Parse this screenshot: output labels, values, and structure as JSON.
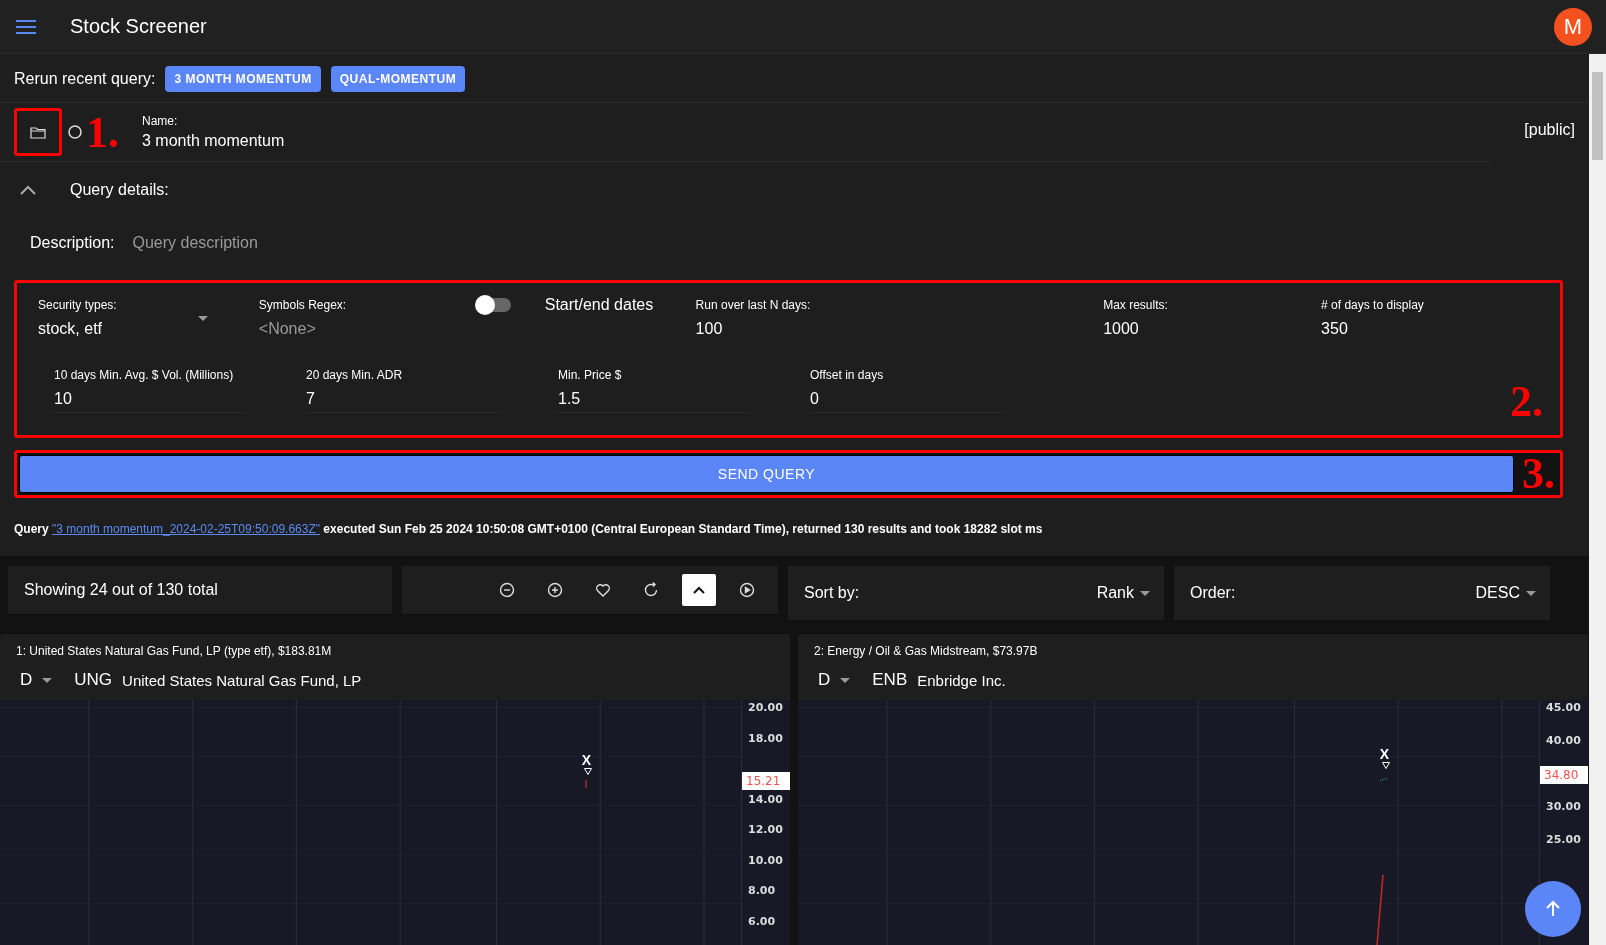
{
  "app_bar": {
    "title": "Stock Screener",
    "avatar": "M"
  },
  "recent_queries": {
    "label": "Rerun recent query:",
    "items": [
      "3 MONTH MOMENTUM",
      "QUAL-MOMENTUM"
    ]
  },
  "query": {
    "name_label": "Name:",
    "name": "3 month momentum",
    "visibility": "[public]",
    "details_label": "Query details:",
    "expanded": true,
    "description_label": "Description:",
    "description_placeholder": "Query description"
  },
  "filters": {
    "row_1": [
      {
        "kind": "select",
        "label": "Security types:",
        "value": "stock, etf"
      },
      {
        "kind": "field",
        "label": "Symbols Regex:",
        "placeholder": "<None>"
      },
      {
        "kind": "toggle",
        "label": "Start/end dates",
        "on": false
      },
      {
        "kind": "field",
        "label": "Run over last N days:",
        "value": "100"
      },
      {
        "kind": "field",
        "label": "Max results:",
        "value": "1000"
      },
      {
        "kind": "field",
        "label": "# of days to display",
        "value": "350"
      }
    ],
    "row_2": [
      {
        "label": "10 days Min. Avg. $ Vol. (Millions)",
        "value": "10"
      },
      {
        "label": "20 days Min. ADR",
        "value": "7"
      },
      {
        "label": "Min. Price $",
        "value": "1.5"
      },
      {
        "label": "Offset in days",
        "value": "0"
      }
    ]
  },
  "send_button": "SEND QUERY",
  "status": {
    "prefix": "Query",
    "link": "\"3 month momentum_2024-02-25T09:50:09.663Z\"",
    "rest": "executed Sun Feb 25 2024 10:50:08 GMT+0100 (Central European Standard Time), returned 130 results and took 18282 slot ms"
  },
  "results": {
    "summary": "Showing 24 out of 130 total",
    "toolbar": [
      {
        "kind": "zoom-out",
        "selected": false
      },
      {
        "kind": "zoom-in",
        "selected": false
      },
      {
        "kind": "favorite",
        "selected": false
      },
      {
        "kind": "refresh",
        "selected": false
      },
      {
        "kind": "collapse",
        "selected": true
      },
      {
        "kind": "play",
        "selected": false
      }
    ],
    "sort": {
      "label": "Sort by:",
      "value": "Rank"
    },
    "order": {
      "label": "Order:",
      "value": "DESC"
    }
  },
  "charts": [
    {
      "title": "1: United States Natural Gas Fund, LP (type etf), $183.81M",
      "interval": "D",
      "symbol": "UNG",
      "name": "United States Natural Gas Fund, LP",
      "y_labels": [
        "20.00",
        "18.00",
        "14.00",
        "12.00",
        "10.00",
        "8.00",
        "6.00"
      ],
      "last_price": "15.21",
      "marker": "X"
    },
    {
      "title": "2: Energy / Oil & Gas Midstream, $73.97B",
      "interval": "D",
      "symbol": "ENB",
      "name": "Enbridge Inc.",
      "y_labels": [
        "45.00",
        "40.00",
        "30.00",
        "25.00"
      ],
      "last_price": "34.80",
      "marker": "X"
    }
  ],
  "annotations": [
    {
      "label": "1."
    },
    {
      "label": "2."
    },
    {
      "label": "3."
    }
  ]
}
